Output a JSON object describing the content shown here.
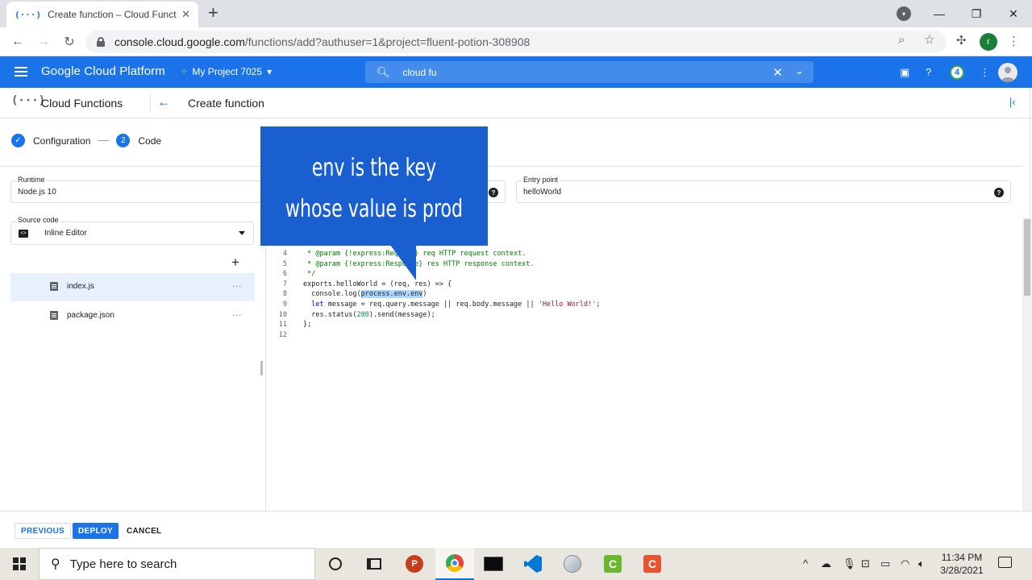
{
  "browser": {
    "tab_title": "Create function – Cloud Function",
    "tab_favicon": "(···)",
    "url_host": "console.cloud.google.com",
    "url_path": "/functions/add?authuser=1&project=fluent-potion-308908",
    "profile_letter": "r"
  },
  "gcp": {
    "brand": "Google Cloud Platform",
    "project": "My Project 7025",
    "search_value": "cloud fu",
    "notification_count": "4"
  },
  "subheader": {
    "product": "Cloud Functions",
    "page_title": "Create function"
  },
  "stepper": {
    "step1_label": "Configuration",
    "step2_number": "2",
    "step2_label": "Code"
  },
  "form": {
    "runtime_label": "Runtime",
    "runtime_value": "Node.js 10",
    "entry_point_label": "Entry point",
    "entry_point_value": "helloWorld",
    "source_label": "Source code",
    "source_value": "Inline Editor"
  },
  "files": [
    {
      "name": "index.js",
      "more": "..."
    },
    {
      "name": "package.json",
      "more": "..."
    }
  ],
  "code": {
    "line_numbers": [
      "4",
      "5",
      "6",
      "7",
      "8",
      "9",
      "10",
      "11",
      "12"
    ]
  },
  "callout": {
    "line1": "env is the key",
    "line2": "whose value is prod"
  },
  "actions": {
    "previous": "PREVIOUS",
    "deploy": "DEPLOY",
    "cancel": "CANCEL"
  },
  "taskbar": {
    "search_placeholder": "Type here to search",
    "time": "11:34 PM",
    "date": "3/28/2021"
  },
  "colors": {
    "gcp_blue": "#1a73e8",
    "callout_blue": "#1a5fd0"
  }
}
